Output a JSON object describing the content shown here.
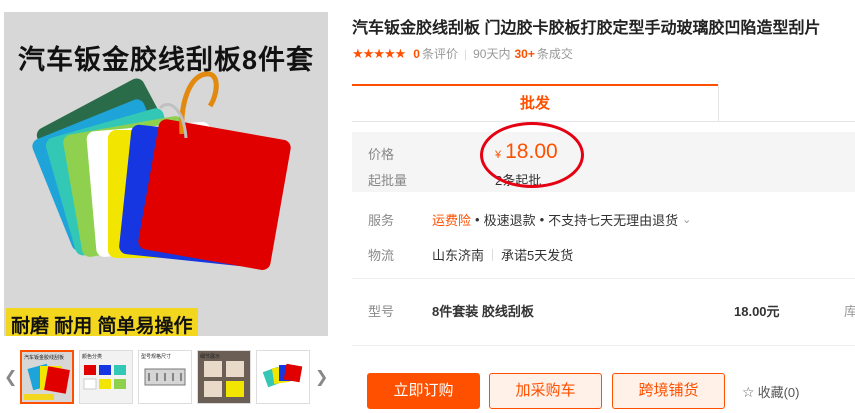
{
  "gallery": {
    "banner_text": "汽车钣金胶线刮板8件套",
    "bottom_tag": "耐磨 耐用 简单易操作",
    "prev_icon": "chevron-left-icon",
    "next_icon": "chevron-right-icon",
    "thumbnails": [
      {
        "caption": "汽车钣金胶线刮板",
        "active": true
      },
      {
        "caption": "颜色分类",
        "active": false
      },
      {
        "caption": "型号规格尺寸",
        "active": false
      },
      {
        "caption": "细节展示",
        "active": false
      },
      {
        "caption": "",
        "active": false
      }
    ]
  },
  "product": {
    "title": "汽车钣金胶线刮板 门边胶卡胶板打胶定型手动玻璃胶凹陷造型刮片",
    "rating_stars": 5,
    "review_count": "0",
    "review_label": "条评价",
    "days_label": "90天内",
    "sold_count": "30+",
    "sold_label": "条成交"
  },
  "tabs": [
    {
      "label": "批发",
      "active": true
    }
  ],
  "price_block": {
    "price_label": "价格",
    "currency": "¥",
    "price": "18.00",
    "min_label": "起批量",
    "min_value": "2条起批"
  },
  "service": {
    "label": "服务",
    "items": [
      "运费险",
      "极速退款",
      "不支持七天无理由退货"
    ]
  },
  "logistics": {
    "label": "物流",
    "origin": "山东济南",
    "promise": "承诺5天发货"
  },
  "sku": {
    "label": "型号",
    "name": "8件套装 胶线刮板",
    "price": "18.00元",
    "more": "库"
  },
  "actions": {
    "buy_now": "立即订购",
    "add_cart": "加采购车",
    "cross_border": "跨境铺货",
    "favorite": "收藏(0)"
  },
  "colors": {
    "accent": "#ff5000",
    "annotation_ring": "#e50012",
    "scraper_colors": [
      "#1fa4d9",
      "#33c7b5",
      "#8fd14f",
      "#ffffff",
      "#f2e600",
      "#1536e0",
      "#e00000",
      "#2a6b4a"
    ]
  }
}
